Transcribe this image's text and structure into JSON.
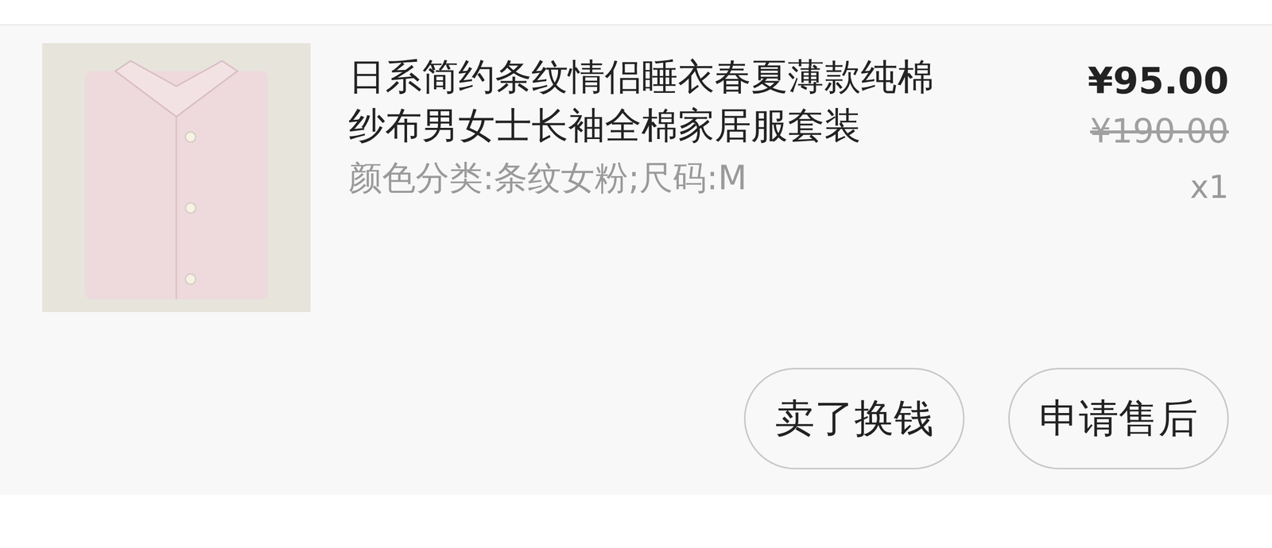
{
  "order_item": {
    "title": "日系简约条纹情侣睡衣春夏薄款纯棉纱布男女士长袖全棉家居服套装",
    "spec": "颜色分类:条纹女粉;尺码:M",
    "price": "¥95.00",
    "original_price": "¥190.00",
    "quantity": "x1"
  },
  "buttons": [
    "卖了换钱",
    "申请售后"
  ]
}
